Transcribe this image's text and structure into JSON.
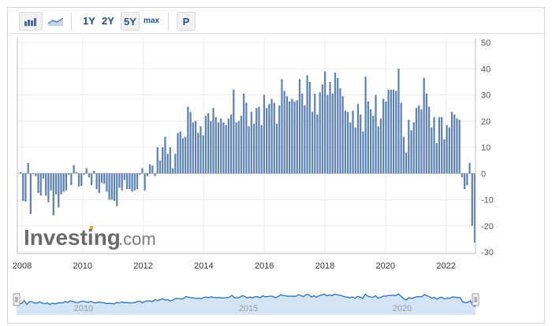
{
  "toolbar": {
    "chart_types": [
      {
        "icon": "bar-chart-icon",
        "selected": true
      },
      {
        "icon": "line-chart-icon",
        "selected": false
      }
    ],
    "ranges": [
      {
        "label": "1Y",
        "selected": false
      },
      {
        "label": "2Y",
        "selected": false
      },
      {
        "label": "5Y",
        "selected": true
      },
      {
        "label": "max",
        "selected": false
      }
    ],
    "p_label": "P"
  },
  "watermark": "Investing.com",
  "colors": {
    "bar": "#5a80b4",
    "navigator_fill": "#d4e4f7",
    "navigator_line": "#2a70b8"
  },
  "chart_data": {
    "type": "bar",
    "title": "",
    "xlabel": "",
    "ylabel": "",
    "x_start": "2008-01",
    "x_tick_labels": [
      "2008",
      "2010",
      "2012",
      "2014",
      "2016",
      "2018",
      "2020",
      "2022"
    ],
    "y_ticks": [
      50,
      40,
      30,
      20,
      10,
      0,
      -10,
      -20,
      -30
    ],
    "ylim": [
      -30,
      50
    ],
    "grid": true,
    "y_axis_side": "right",
    "navigator_labels": [
      "2010",
      "2015",
      "2020"
    ],
    "values": [
      0.5,
      -10.5,
      -10.8,
      4,
      -15.5,
      -0.3,
      -1,
      -7.5,
      -8.5,
      -2,
      -8.5,
      -11,
      -6.5,
      -16,
      -8,
      -13,
      -8,
      -7,
      -6.5,
      -0.5,
      -4.5,
      3.2,
      0.5,
      -5,
      -4.8,
      -0.5,
      2,
      -1.5,
      -4.5,
      1,
      -6,
      -7.5,
      -3.5,
      -4,
      -7,
      -10,
      -10,
      -10.5,
      -12.5,
      -5.5,
      -6.5,
      -2.5,
      -6,
      -6,
      -7,
      -6.5,
      -6,
      -0.5,
      2,
      -6.5,
      -1,
      3.5,
      3,
      -1,
      10,
      5,
      10,
      14,
      7.5,
      10,
      2,
      7.5,
      15.5,
      16,
      13.5,
      14,
      25.5,
      23.5,
      19.5,
      20,
      15.5,
      18,
      14.5,
      22,
      23,
      20,
      25,
      21.5,
      19.5,
      21,
      19.5,
      18.5,
      21,
      22.5,
      32,
      19.5,
      20,
      22,
      30.5,
      27,
      18,
      23.5,
      19,
      25,
      25.5,
      18.5,
      30,
      25,
      26.5,
      28.5,
      27,
      19,
      26,
      36,
      31.5,
      29.5,
      27.5,
      28.5,
      27.5,
      28,
      36,
      30.5,
      26,
      37.5,
      35,
      23.5,
      30.5,
      22.5,
      31,
      34,
      39,
      30,
      35,
      30.5,
      38.5,
      36.5,
      32.5,
      29.5,
      24,
      23.5,
      19.5,
      24,
      17.5,
      26.5,
      22.5,
      16,
      37,
      27.5,
      24.5,
      22,
      30,
      18,
      21,
      28.5,
      27.5,
      32,
      32,
      32,
      31.5,
      40,
      27,
      14,
      8,
      20.5,
      16.5,
      19.5,
      25,
      26,
      24.5,
      36.5,
      30.5,
      25.5,
      17.5,
      21.5,
      11.5,
      21.5,
      21.5,
      13,
      18.5,
      17.5,
      23.5,
      22.5,
      21,
      20.5,
      -1.5,
      -6,
      -4.5,
      4,
      -20,
      -26.5
    ]
  }
}
